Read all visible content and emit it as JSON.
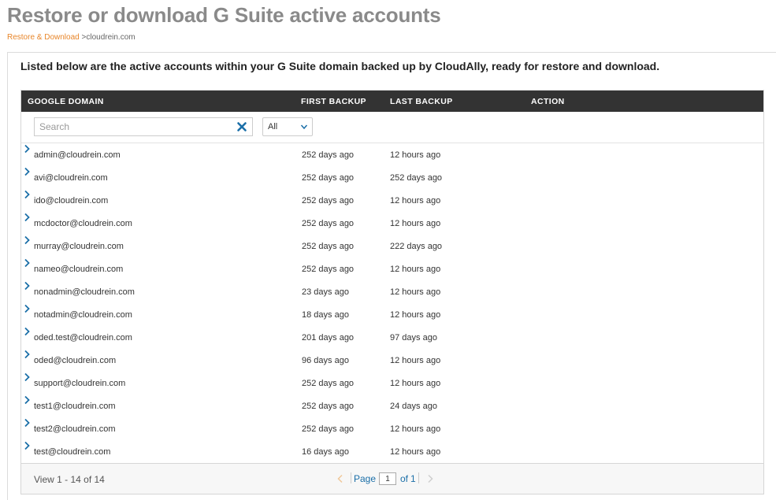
{
  "page": {
    "title": "Restore or download G Suite active accounts",
    "breadcrumb": {
      "link": "Restore & Download",
      "separator": ">",
      "current": "cloudrein.com"
    }
  },
  "intro": "Listed below are the active accounts within your G Suite domain backed up by CloudAlly, ready for restore and download.",
  "table": {
    "columns": [
      "GOOGLE DOMAIN",
      "FIRST BACKUP",
      "LAST BACKUP",
      "ACTION"
    ],
    "search_placeholder": "Search",
    "search_value": "",
    "filter_selected": "All",
    "action_icon": "chevron-right-icon",
    "rows": [
      {
        "domain": "admin@cloudrein.com",
        "first": "252 days ago",
        "last": "12 hours ago"
      },
      {
        "domain": "avi@cloudrein.com",
        "first": "252 days ago",
        "last": "252 days ago"
      },
      {
        "domain": "ido@cloudrein.com",
        "first": "252 days ago",
        "last": "12 hours ago"
      },
      {
        "domain": "mcdoctor@cloudrein.com",
        "first": "252 days ago",
        "last": "12 hours ago"
      },
      {
        "domain": "murray@cloudrein.com",
        "first": "252 days ago",
        "last": "222 days ago"
      },
      {
        "domain": "nameo@cloudrein.com",
        "first": "252 days ago",
        "last": "12 hours ago"
      },
      {
        "domain": "nonadmin@cloudrein.com",
        "first": "23 days ago",
        "last": "12 hours ago"
      },
      {
        "domain": "notadmin@cloudrein.com",
        "first": "18 days ago",
        "last": "12 hours ago"
      },
      {
        "domain": "oded.test@cloudrein.com",
        "first": "201 days ago",
        "last": "97 days ago"
      },
      {
        "domain": "oded@cloudrein.com",
        "first": "96 days ago",
        "last": "12 hours ago"
      },
      {
        "domain": "support@cloudrein.com",
        "first": "252 days ago",
        "last": "12 hours ago"
      },
      {
        "domain": "test1@cloudrein.com",
        "first": "252 days ago",
        "last": "24 days ago"
      },
      {
        "domain": "test2@cloudrein.com",
        "first": "252 days ago",
        "last": "12 hours ago"
      },
      {
        "domain": "test@cloudrein.com",
        "first": "16 days ago",
        "last": "12 hours ago"
      }
    ],
    "footer": {
      "view_text": "View 1 - 14 of 14",
      "page_label": "Page",
      "page_value": "1",
      "of_label": "of",
      "total_pages": "1"
    }
  },
  "colors": {
    "title": "#8a8a8a",
    "link": "#e8862a",
    "header_bg": "#333333",
    "accent": "#1b6fa8"
  }
}
